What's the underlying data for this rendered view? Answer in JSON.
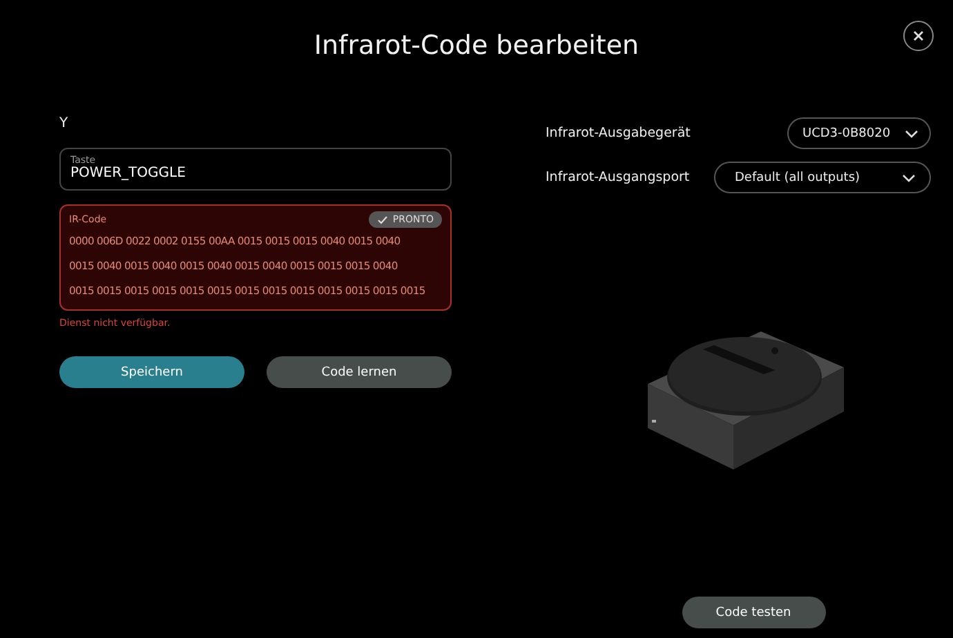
{
  "title": "Infrarot-Code bearbeiten",
  "button_name": "Y",
  "key_field": {
    "label": "Taste",
    "value": "POWER_TOGGLE"
  },
  "ir_code": {
    "label": "IR-Code",
    "invalid": true,
    "pronto": {
      "label": "PRONTO",
      "on": true
    },
    "lines": [
      "0000 006D 0022 0002 0155 00AA 0015 0015 0015 0040 0015 0040",
      "0015 0040 0015 0040 0015 0040 0015 0040 0015 0015 0015 0040",
      "0015 0015 0015 0015 0015 0015 0015 0015 0015 0015 0015 0015 0015"
    ]
  },
  "error": "Dienst nicht verfügbar.",
  "buttons": [
    {
      "label": "Speichern",
      "kind": "primary"
    },
    {
      "label": "Code lernen",
      "kind": "secondary"
    }
  ],
  "output_device": {
    "label": "Infrarot-Ausgabegerät",
    "value": "UCD3-0B8020"
  },
  "output_port": {
    "label": "Infrarot-Ausgangsport",
    "value": "Default (all outputs)"
  },
  "test_button": {
    "label": "Code testen"
  }
}
